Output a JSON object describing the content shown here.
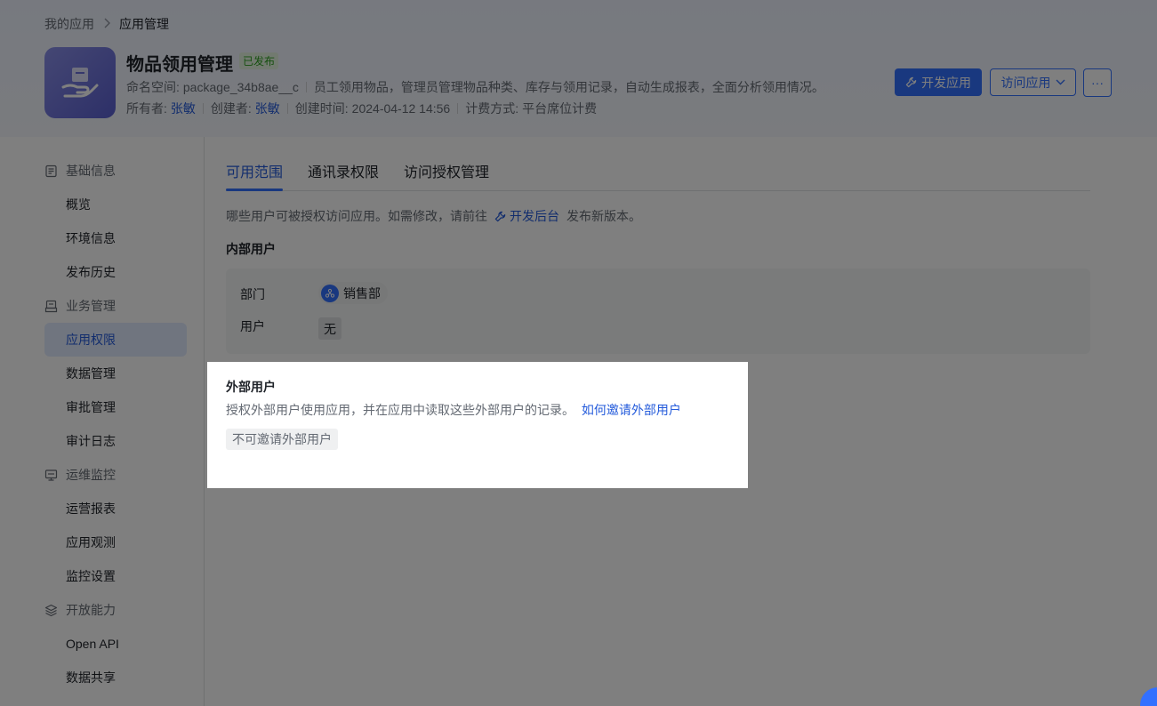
{
  "breadcrumb": {
    "parent": "我的应用",
    "current": "应用管理"
  },
  "app": {
    "name": "物品领用管理",
    "status": "已发布",
    "namespace_label": "命名空间:",
    "namespace": "package_34b8ae__c",
    "description": "员工领用物品，管理员管理物品种类、库存与领用记录，自动生成报表，全面分析领用情况。",
    "owner_label": "所有者:",
    "owner": "张敏",
    "creator_label": "创建者:",
    "creator": "张敏",
    "created_label": "创建时间:",
    "created_at": "2024-04-12 14:56",
    "billing_label": "计费方式:",
    "billing": "平台席位计费"
  },
  "actions": {
    "dev": "开发应用",
    "visit": "访问应用",
    "more": "···"
  },
  "sidebar": {
    "groups": [
      {
        "label": "基础信息",
        "icon": "document-icon",
        "items": [
          "概览",
          "环境信息",
          "发布历史"
        ]
      },
      {
        "label": "业务管理",
        "icon": "archive-icon",
        "items": [
          "应用权限",
          "数据管理",
          "审批管理",
          "审计日志"
        ]
      },
      {
        "label": "运维监控",
        "icon": "monitor-icon",
        "items": [
          "运营报表",
          "应用观测",
          "监控设置"
        ]
      },
      {
        "label": "开放能力",
        "icon": "layers-icon",
        "items": [
          "Open API",
          "数据共享"
        ]
      }
    ],
    "active_item": "应用权限"
  },
  "tabs": [
    "可用范围",
    "通讯录权限",
    "访问授权管理"
  ],
  "active_tab": "可用范围",
  "scope": {
    "description_before": "哪些用户可被授权访问应用。如需修改，请前往",
    "link": "开发后台",
    "description_after": "发布新版本。",
    "internal_title": "内部用户",
    "dept_label": "部门",
    "dept_value": "销售部",
    "user_label": "用户",
    "user_value": "无"
  },
  "external": {
    "title": "外部用户",
    "description": "授权外部用户使用应用，并在应用中读取这些外部用户的记录。",
    "link": "如何邀请外部用户",
    "status": "不可邀请外部用户"
  },
  "colors": {
    "accent": "#3370ff",
    "link": "#245bdb",
    "published": "#2ea121"
  }
}
